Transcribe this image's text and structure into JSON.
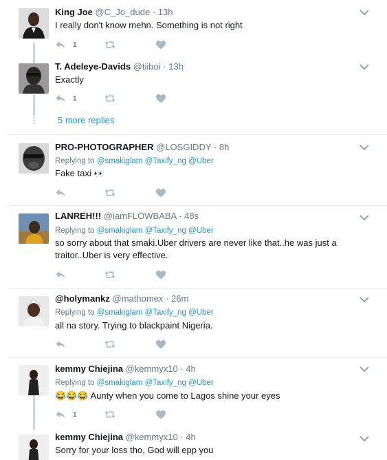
{
  "tweets": [
    {
      "name": "King Joe",
      "handle": "@C_Jo_dude",
      "sep": "·",
      "time": "13h",
      "text": "I really don't know mehn. Something is not right",
      "reply_count": "1"
    },
    {
      "name": "T. Adeleye-Davids",
      "handle": "@tiiboi",
      "sep": "·",
      "time": "13h",
      "text": "Exactly",
      "reply_count": "1"
    },
    {
      "name": "PRO-PHOTOGRAPHER",
      "handle": "@LOSGIDDY",
      "sep": "·",
      "time": "8h",
      "replying_label": "Replying to",
      "mentions": [
        "@smakiglam",
        "@Taxify_ng",
        "@Uber"
      ],
      "text": "Fake taxi 👀"
    },
    {
      "name": "LANREH!!!",
      "handle": "@iamFLOWBABA",
      "sep": "·",
      "time": "48s",
      "replying_label": "Replying to",
      "mentions": [
        "@smakiglam",
        "@Taxify_ng",
        "@Uber"
      ],
      "text_line1": "so sorry about that smaki.Uber drivers are never  like that..he was just a",
      "text_line2": "traitor..Uber is very effective."
    },
    {
      "name": "@holymankz",
      "handle": "@mathomex",
      "sep": "·",
      "time": "26m",
      "replying_label": "Replying to",
      "mentions": [
        "@smakiglam",
        "@Taxify_ng",
        "@Uber"
      ],
      "text": "all na story. Trying to blackpaint Nigeria."
    },
    {
      "name": "kemmy Chiejina",
      "handle": "@kemmyx10",
      "sep": "·",
      "time": "4h",
      "replying_label": "Replying to",
      "mentions": [
        "@smakiglam",
        "@Taxify_ng",
        "@Uber"
      ],
      "emojis": "😂😂😂",
      "text": " Aunty when you come to Lagos shine your eyes",
      "reply_count": "1"
    },
    {
      "name": "kemmy Chiejina",
      "handle": "@kemmyx10",
      "sep": "·",
      "time": "4h",
      "text": "Sorry for your loss tho, God will epp you"
    }
  ],
  "more_replies": "5 more replies",
  "icons": {
    "reply": "reply-icon",
    "retweet": "retweet-icon",
    "like": "heart-icon",
    "menu": "chevron-down-icon"
  },
  "colors": {
    "link": "#1b95e0",
    "muted": "#657786",
    "icon": "#aab8c2",
    "divider": "#e6ecf0",
    "thread": "#ccd6dd"
  }
}
